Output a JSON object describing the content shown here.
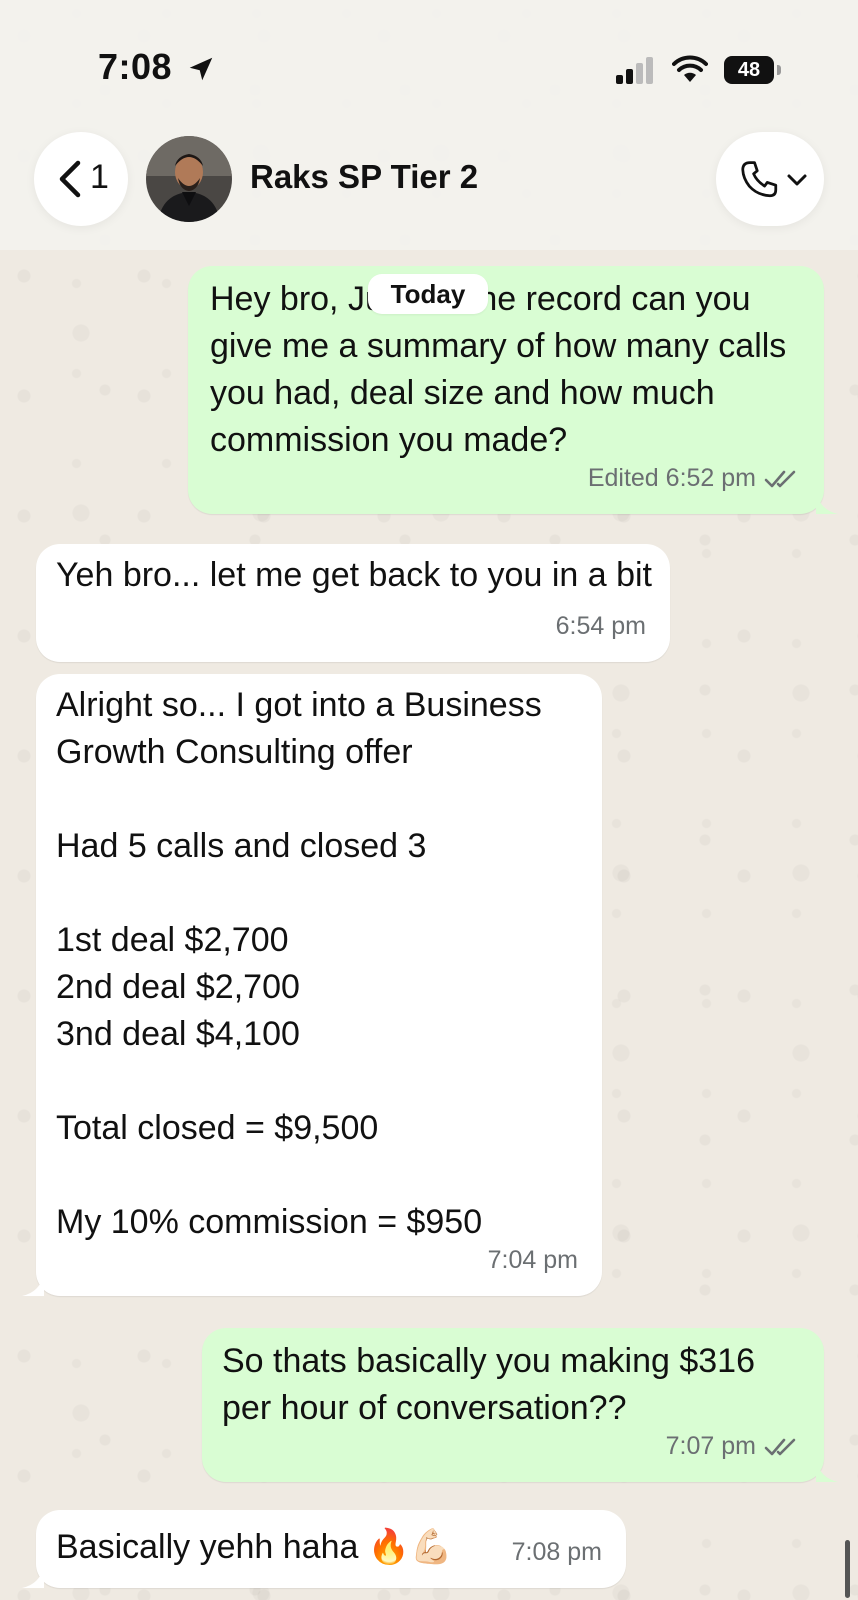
{
  "status_bar": {
    "time": "7:08",
    "battery": "48"
  },
  "header": {
    "back_count": "1",
    "contact_name": "Raks SP Tier 2"
  },
  "date_divider": "Today",
  "messages": [
    {
      "direction": "out",
      "text": "Hey bro, Just for the record can you give me a summary of how many calls you had, deal size and how much commission you made?",
      "meta": "Edited 6:52 pm",
      "read": true
    },
    {
      "direction": "in",
      "text": "Yeh bro... let me get back to you in a bit",
      "meta": "6:54 pm"
    },
    {
      "direction": "in",
      "text": "Alright so... I got into a Business Growth Consulting offer\n\nHad 5 calls and closed 3\n\n1st deal $2,700\n2nd deal $2,700\n3nd deal $4,100\n\nTotal closed = $9,500\n\nMy 10% commission = $950",
      "meta": "7:04 pm"
    },
    {
      "direction": "out",
      "text": "So thats basically you making $316 per hour of conversation??",
      "meta": "7:07 pm",
      "read": true
    },
    {
      "direction": "in",
      "text": "Basically yehh haha",
      "emoji": "🔥💪🏻",
      "meta": "7:08 pm"
    }
  ],
  "colors": {
    "outgoing_bubble": "#d9fdd3",
    "incoming_bubble": "#ffffff",
    "chat_background": "#efeae2",
    "read_ticks": "#6b6f72"
  },
  "icons": [
    "location-arrow-icon",
    "signal-icon",
    "wifi-icon",
    "battery-icon",
    "chevron-left-icon",
    "phone-icon",
    "chevron-down-icon",
    "double-check-icon"
  ]
}
